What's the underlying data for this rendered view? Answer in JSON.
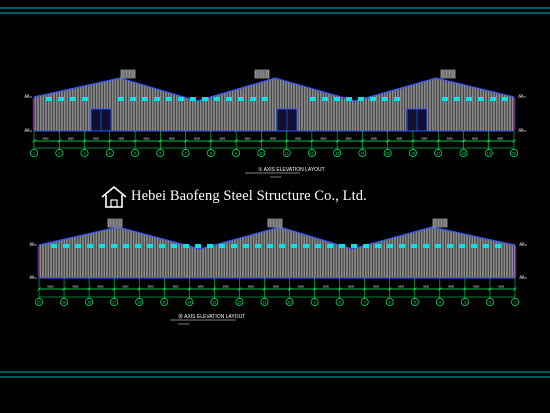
{
  "watermark": {
    "text": "Hebei Baofeng Steel Structure Co., Ltd.",
    "icon": "house-icon"
  },
  "top_drawing": {
    "caption": "① AXIS ELEVATION LAYOUT",
    "axis_count": 20,
    "axis_labels": [
      "1",
      "2",
      "3",
      "4",
      "5",
      "6",
      "7",
      "8",
      "9",
      "10",
      "11",
      "12",
      "13",
      "14",
      "15",
      "16",
      "17",
      "18",
      "19",
      "20"
    ]
  },
  "bottom_drawing": {
    "caption": "⑳ AXIS ELEVATION LAYOUT",
    "axis_count": 20,
    "axis_labels": [
      "20",
      "19",
      "18",
      "17",
      "16",
      "15",
      "14",
      "13",
      "12",
      "11",
      "10",
      "9",
      "8",
      "7",
      "6",
      "5",
      "4",
      "3",
      "2",
      "1"
    ]
  },
  "colors": {
    "background": "#000000",
    "cladding": "#d0d0d0",
    "roof_outline": "#3355ff",
    "window": "#00e5e5",
    "door": "#2b56ff",
    "dimension": "#00ff66",
    "frame": "#00b7b7",
    "label": "#ffffff",
    "marker": "#ff3030"
  }
}
